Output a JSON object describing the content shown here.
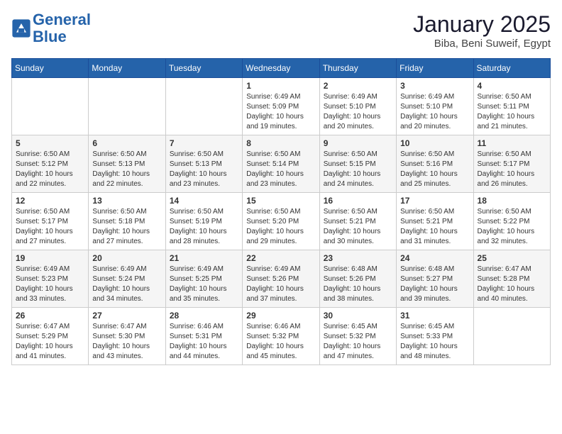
{
  "header": {
    "logo_line1": "General",
    "logo_line2": "Blue",
    "month_title": "January 2025",
    "location": "Biba, Beni Suweif, Egypt"
  },
  "days_of_week": [
    "Sunday",
    "Monday",
    "Tuesday",
    "Wednesday",
    "Thursday",
    "Friday",
    "Saturday"
  ],
  "weeks": [
    [
      {
        "day": "",
        "info": ""
      },
      {
        "day": "",
        "info": ""
      },
      {
        "day": "",
        "info": ""
      },
      {
        "day": "1",
        "info": "Sunrise: 6:49 AM\nSunset: 5:09 PM\nDaylight: 10 hours\nand 19 minutes."
      },
      {
        "day": "2",
        "info": "Sunrise: 6:49 AM\nSunset: 5:10 PM\nDaylight: 10 hours\nand 20 minutes."
      },
      {
        "day": "3",
        "info": "Sunrise: 6:49 AM\nSunset: 5:10 PM\nDaylight: 10 hours\nand 20 minutes."
      },
      {
        "day": "4",
        "info": "Sunrise: 6:50 AM\nSunset: 5:11 PM\nDaylight: 10 hours\nand 21 minutes."
      }
    ],
    [
      {
        "day": "5",
        "info": "Sunrise: 6:50 AM\nSunset: 5:12 PM\nDaylight: 10 hours\nand 22 minutes."
      },
      {
        "day": "6",
        "info": "Sunrise: 6:50 AM\nSunset: 5:13 PM\nDaylight: 10 hours\nand 22 minutes."
      },
      {
        "day": "7",
        "info": "Sunrise: 6:50 AM\nSunset: 5:13 PM\nDaylight: 10 hours\nand 23 minutes."
      },
      {
        "day": "8",
        "info": "Sunrise: 6:50 AM\nSunset: 5:14 PM\nDaylight: 10 hours\nand 23 minutes."
      },
      {
        "day": "9",
        "info": "Sunrise: 6:50 AM\nSunset: 5:15 PM\nDaylight: 10 hours\nand 24 minutes."
      },
      {
        "day": "10",
        "info": "Sunrise: 6:50 AM\nSunset: 5:16 PM\nDaylight: 10 hours\nand 25 minutes."
      },
      {
        "day": "11",
        "info": "Sunrise: 6:50 AM\nSunset: 5:17 PM\nDaylight: 10 hours\nand 26 minutes."
      }
    ],
    [
      {
        "day": "12",
        "info": "Sunrise: 6:50 AM\nSunset: 5:17 PM\nDaylight: 10 hours\nand 27 minutes."
      },
      {
        "day": "13",
        "info": "Sunrise: 6:50 AM\nSunset: 5:18 PM\nDaylight: 10 hours\nand 27 minutes."
      },
      {
        "day": "14",
        "info": "Sunrise: 6:50 AM\nSunset: 5:19 PM\nDaylight: 10 hours\nand 28 minutes."
      },
      {
        "day": "15",
        "info": "Sunrise: 6:50 AM\nSunset: 5:20 PM\nDaylight: 10 hours\nand 29 minutes."
      },
      {
        "day": "16",
        "info": "Sunrise: 6:50 AM\nSunset: 5:21 PM\nDaylight: 10 hours\nand 30 minutes."
      },
      {
        "day": "17",
        "info": "Sunrise: 6:50 AM\nSunset: 5:21 PM\nDaylight: 10 hours\nand 31 minutes."
      },
      {
        "day": "18",
        "info": "Sunrise: 6:50 AM\nSunset: 5:22 PM\nDaylight: 10 hours\nand 32 minutes."
      }
    ],
    [
      {
        "day": "19",
        "info": "Sunrise: 6:49 AM\nSunset: 5:23 PM\nDaylight: 10 hours\nand 33 minutes."
      },
      {
        "day": "20",
        "info": "Sunrise: 6:49 AM\nSunset: 5:24 PM\nDaylight: 10 hours\nand 34 minutes."
      },
      {
        "day": "21",
        "info": "Sunrise: 6:49 AM\nSunset: 5:25 PM\nDaylight: 10 hours\nand 35 minutes."
      },
      {
        "day": "22",
        "info": "Sunrise: 6:49 AM\nSunset: 5:26 PM\nDaylight: 10 hours\nand 37 minutes."
      },
      {
        "day": "23",
        "info": "Sunrise: 6:48 AM\nSunset: 5:26 PM\nDaylight: 10 hours\nand 38 minutes."
      },
      {
        "day": "24",
        "info": "Sunrise: 6:48 AM\nSunset: 5:27 PM\nDaylight: 10 hours\nand 39 minutes."
      },
      {
        "day": "25",
        "info": "Sunrise: 6:47 AM\nSunset: 5:28 PM\nDaylight: 10 hours\nand 40 minutes."
      }
    ],
    [
      {
        "day": "26",
        "info": "Sunrise: 6:47 AM\nSunset: 5:29 PM\nDaylight: 10 hours\nand 41 minutes."
      },
      {
        "day": "27",
        "info": "Sunrise: 6:47 AM\nSunset: 5:30 PM\nDaylight: 10 hours\nand 43 minutes."
      },
      {
        "day": "28",
        "info": "Sunrise: 6:46 AM\nSunset: 5:31 PM\nDaylight: 10 hours\nand 44 minutes."
      },
      {
        "day": "29",
        "info": "Sunrise: 6:46 AM\nSunset: 5:32 PM\nDaylight: 10 hours\nand 45 minutes."
      },
      {
        "day": "30",
        "info": "Sunrise: 6:45 AM\nSunset: 5:32 PM\nDaylight: 10 hours\nand 47 minutes."
      },
      {
        "day": "31",
        "info": "Sunrise: 6:45 AM\nSunset: 5:33 PM\nDaylight: 10 hours\nand 48 minutes."
      },
      {
        "day": "",
        "info": ""
      }
    ]
  ]
}
